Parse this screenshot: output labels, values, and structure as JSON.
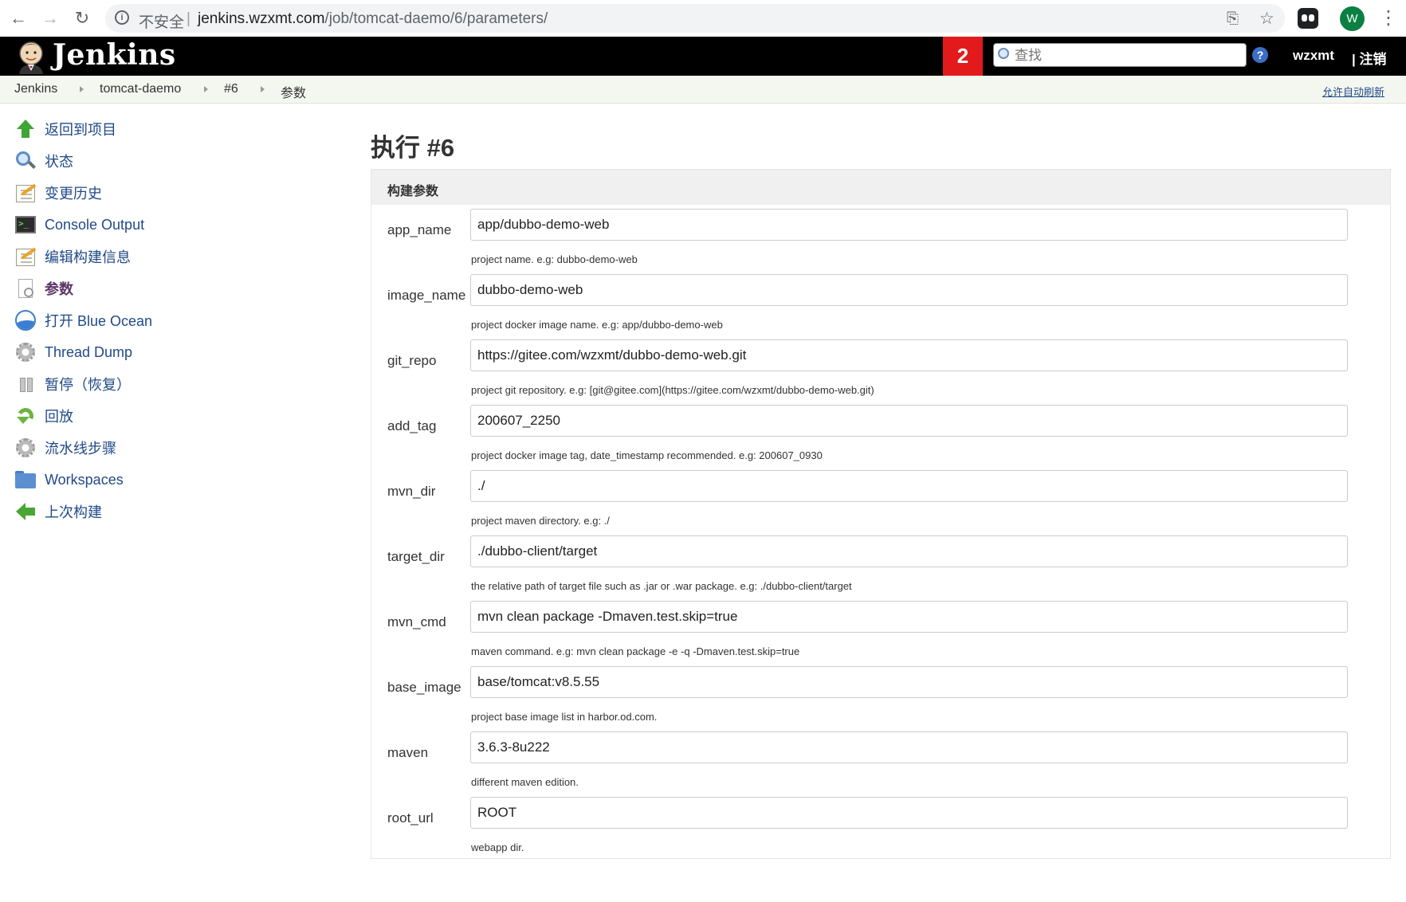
{
  "browser": {
    "insecure_label": "不安全",
    "separator": "|",
    "url_host": "jenkins.wzxmt.com",
    "url_path": "/job/tomcat-daemo/6/parameters/",
    "profile_initial": "W"
  },
  "header": {
    "brand": "Jenkins",
    "notification_count": "2",
    "search_placeholder": "查找",
    "help_label": "?",
    "username": "wzxmt",
    "logout": "| 注销"
  },
  "breadcrumb": {
    "items": [
      "Jenkins",
      "tomcat-daemo",
      "#6",
      "参数"
    ],
    "auto_refresh": "允许自动刷新"
  },
  "sidebar": {
    "items": [
      {
        "label": "返回到项目",
        "icon": "up-arrow-icon"
      },
      {
        "label": "状态",
        "icon": "search-icon"
      },
      {
        "label": "变更历史",
        "icon": "notepad-icon"
      },
      {
        "label": "Console Output",
        "icon": "terminal-icon"
      },
      {
        "label": "编辑构建信息",
        "icon": "notepad-icon"
      },
      {
        "label": "参数",
        "icon": "document-icon"
      },
      {
        "label": "打开 Blue Ocean",
        "icon": "blue-ocean-icon"
      },
      {
        "label": "Thread Dump",
        "icon": "gear-icon"
      },
      {
        "label": "暂停（恢复）",
        "icon": "pause-icon"
      },
      {
        "label": "回放",
        "icon": "replay-icon"
      },
      {
        "label": "流水线步骤",
        "icon": "gear-icon"
      },
      {
        "label": "Workspaces",
        "icon": "folder-icon"
      },
      {
        "label": "上次构建",
        "icon": "left-arrow-icon"
      }
    ]
  },
  "main": {
    "title": "执行 #6",
    "section_title": "构建参数",
    "params": [
      {
        "name": "app_name",
        "value": "app/dubbo-demo-web",
        "desc": "project name. e.g: dubbo-demo-web"
      },
      {
        "name": "image_name",
        "value": "dubbo-demo-web",
        "desc": "project docker image name. e.g: app/dubbo-demo-web"
      },
      {
        "name": "git_repo",
        "value": "https://gitee.com/wzxmt/dubbo-demo-web.git",
        "desc": "project git repository. e.g: [git@gitee.com](https://gitee.com/wzxmt/dubbo-demo-web.git)"
      },
      {
        "name": "add_tag",
        "value": "200607_2250",
        "desc": "project docker image tag, date_timestamp recommended. e.g: 200607_0930"
      },
      {
        "name": "mvn_dir",
        "value": "./",
        "desc": "project maven directory. e.g: ./"
      },
      {
        "name": "target_dir",
        "value": "./dubbo-client/target",
        "desc": "the relative path of target file such as .jar or .war package. e.g: ./dubbo-client/target"
      },
      {
        "name": "mvn_cmd",
        "value": "mvn clean package -Dmaven.test.skip=true",
        "desc": "maven command. e.g: mvn clean package -e -q -Dmaven.test.skip=true"
      },
      {
        "name": "base_image",
        "value": "base/tomcat:v8.5.55",
        "desc": "project base image list in harbor.od.com."
      },
      {
        "name": "maven",
        "value": "3.6.3-8u222",
        "desc": "different maven edition."
      },
      {
        "name": "root_url",
        "value": "ROOT",
        "desc": "webapp dir."
      }
    ]
  }
}
